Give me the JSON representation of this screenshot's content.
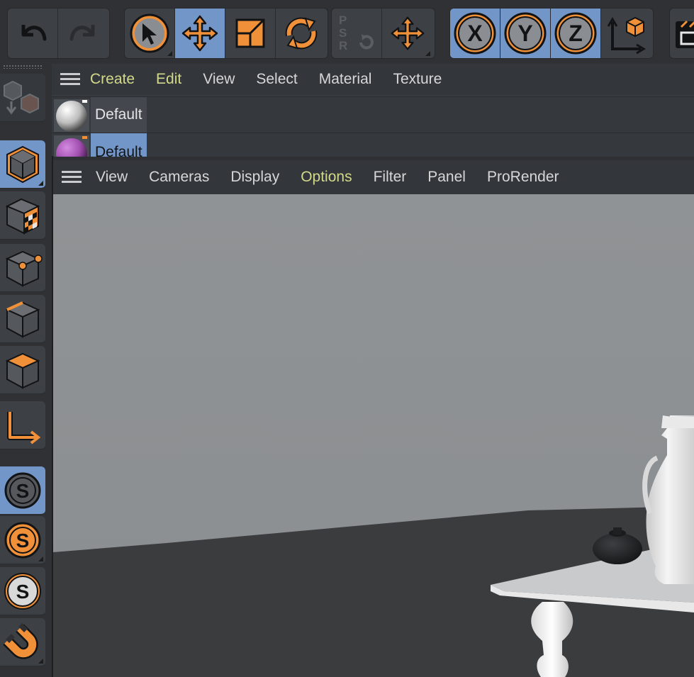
{
  "material_menu": {
    "items": [
      {
        "label": "Create",
        "highlight": true
      },
      {
        "label": "Edit",
        "highlight": true
      },
      {
        "label": "View",
        "highlight": false
      },
      {
        "label": "Select",
        "highlight": false
      },
      {
        "label": "Material",
        "highlight": false
      },
      {
        "label": "Texture",
        "highlight": false
      }
    ]
  },
  "materials": [
    {
      "name": "Default",
      "selected": false,
      "swatch": "#e0e0e0"
    },
    {
      "name": "Default",
      "selected": true,
      "swatch": "#a24fb0"
    }
  ],
  "viewport_menu": {
    "items": [
      {
        "label": "View",
        "highlight": false
      },
      {
        "label": "Cameras",
        "highlight": false
      },
      {
        "label": "Display",
        "highlight": false
      },
      {
        "label": "Options",
        "highlight": true
      },
      {
        "label": "Filter",
        "highlight": false
      },
      {
        "label": "Panel",
        "highlight": false
      },
      {
        "label": "ProRender",
        "highlight": false
      }
    ]
  },
  "toolbar": {
    "undo": "undo-icon",
    "redo": "redo-icon",
    "psr_letters": [
      "P",
      "S",
      "R"
    ],
    "axis_x": "X",
    "axis_y": "Y",
    "axis_z": "Z"
  },
  "left_tools": {
    "snap_letter": "S"
  },
  "colors": {
    "accent": "#f0913a",
    "selection": "#7396c9",
    "menu_highlight": "#d3d98a",
    "panel": "#3d4045"
  }
}
